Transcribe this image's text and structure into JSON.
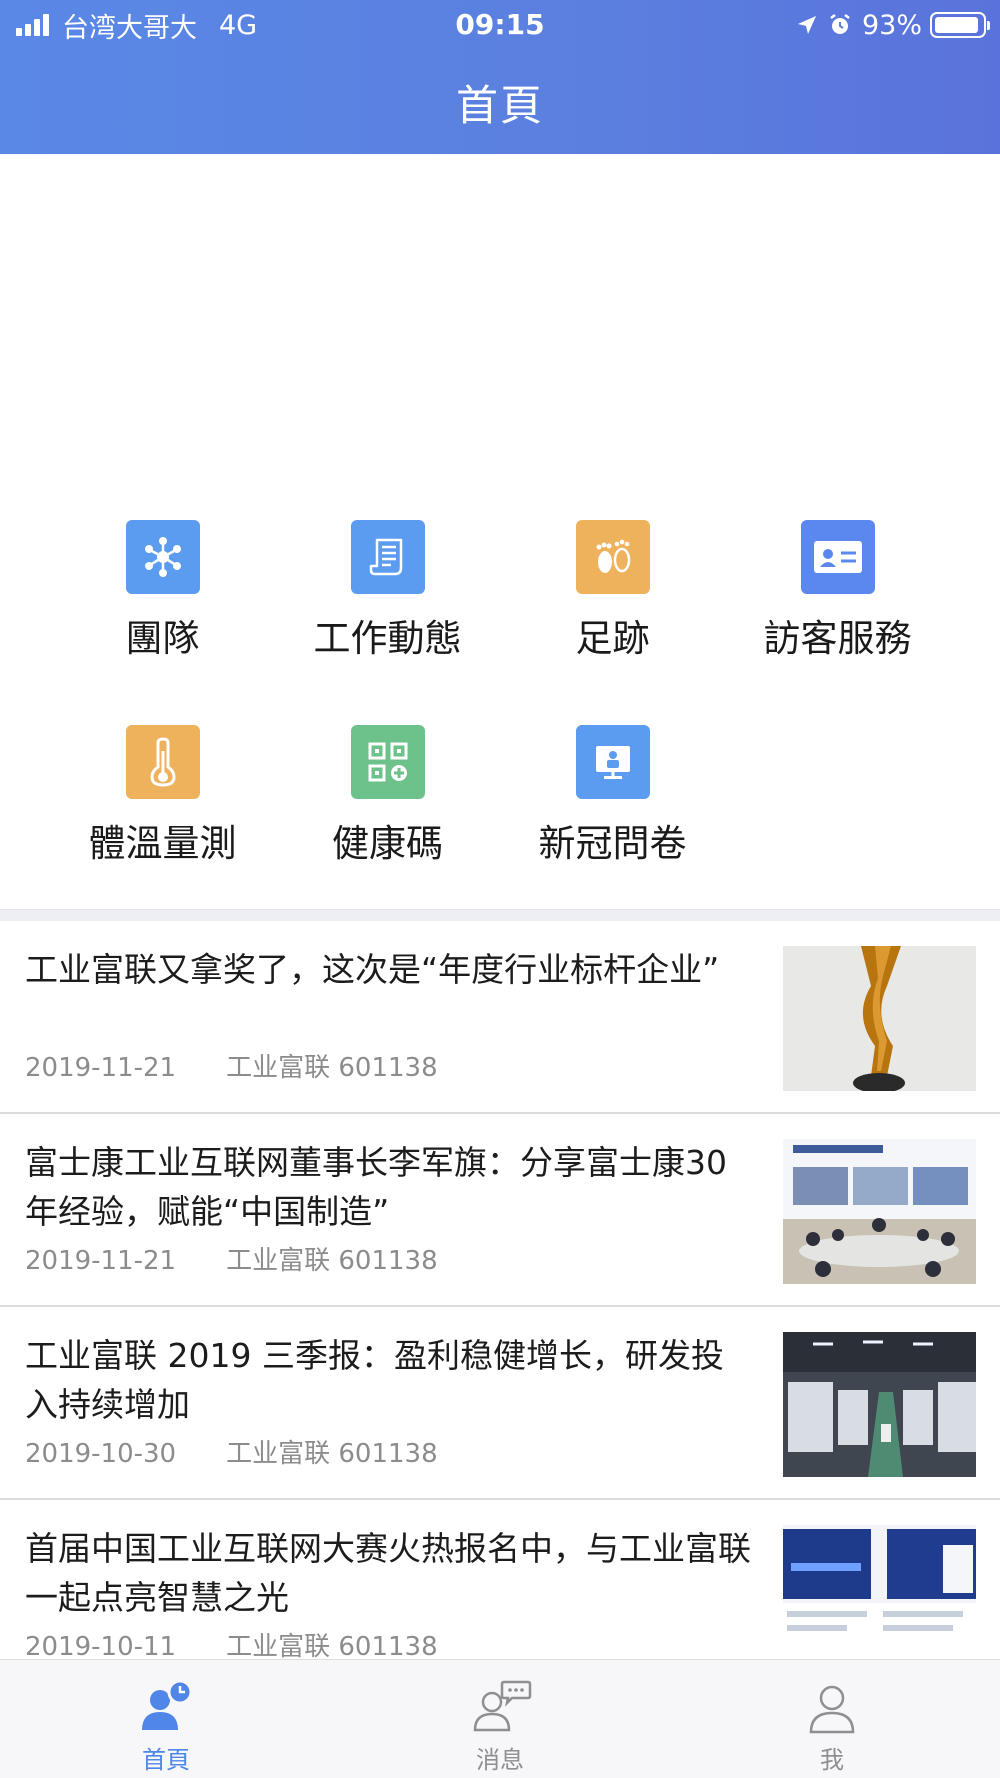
{
  "status_bar": {
    "carrier": "台湾大哥大",
    "network": "4G",
    "time": "09:15",
    "battery": "93%",
    "battery_level": 0.93
  },
  "header": {
    "title": "首頁"
  },
  "grid": [
    {
      "label": "團隊",
      "icon": "team-network-icon",
      "color": "#5b9cf0"
    },
    {
      "label": "工作動態",
      "icon": "work-document-icon",
      "color": "#5b9cf0"
    },
    {
      "label": "足跡",
      "icon": "footprints-icon",
      "color": "#efb25c"
    },
    {
      "label": "訪客服務",
      "icon": "id-card-icon",
      "color": "#5b88ee"
    },
    {
      "label": "體溫量測",
      "icon": "thermometer-icon",
      "color": "#efb25c"
    },
    {
      "label": "健康碼",
      "icon": "qr-code-icon",
      "color": "#6cc28a"
    },
    {
      "label": "新冠問卷",
      "icon": "survey-monitor-icon",
      "color": "#5b9cf0"
    }
  ],
  "news": [
    {
      "title": "工业富联又拿奖了，这次是“年度行业标杆企业”",
      "date": "2019-11-21",
      "source": "工业富联 601138"
    },
    {
      "title": "富士康工业互联网董事长李军旗：分享富士康30年经验，赋能“中国制造”",
      "date": "2019-11-21",
      "source": "工业富联 601138"
    },
    {
      "title": "工业富联 2019 三季报：盈利稳健增长，研发投入持续增加",
      "date": "2019-10-30",
      "source": "工业富联 601138"
    },
    {
      "title": "首届中国工业互联网大赛火热报名中，与工业富联一起点亮智慧之光",
      "date": "2019-10-11",
      "source": "工业富联 601138"
    }
  ],
  "tabs": [
    {
      "label": "首頁",
      "icon": "home-person-clock-icon",
      "active": true
    },
    {
      "label": "消息",
      "icon": "messages-person-chat-icon",
      "active": false
    },
    {
      "label": "我",
      "icon": "me-person-icon",
      "active": false
    }
  ],
  "colors": {
    "accent": "#5b7fdf",
    "active_tab": "#4f86e8",
    "inactive_tab": "#8e8e93"
  }
}
